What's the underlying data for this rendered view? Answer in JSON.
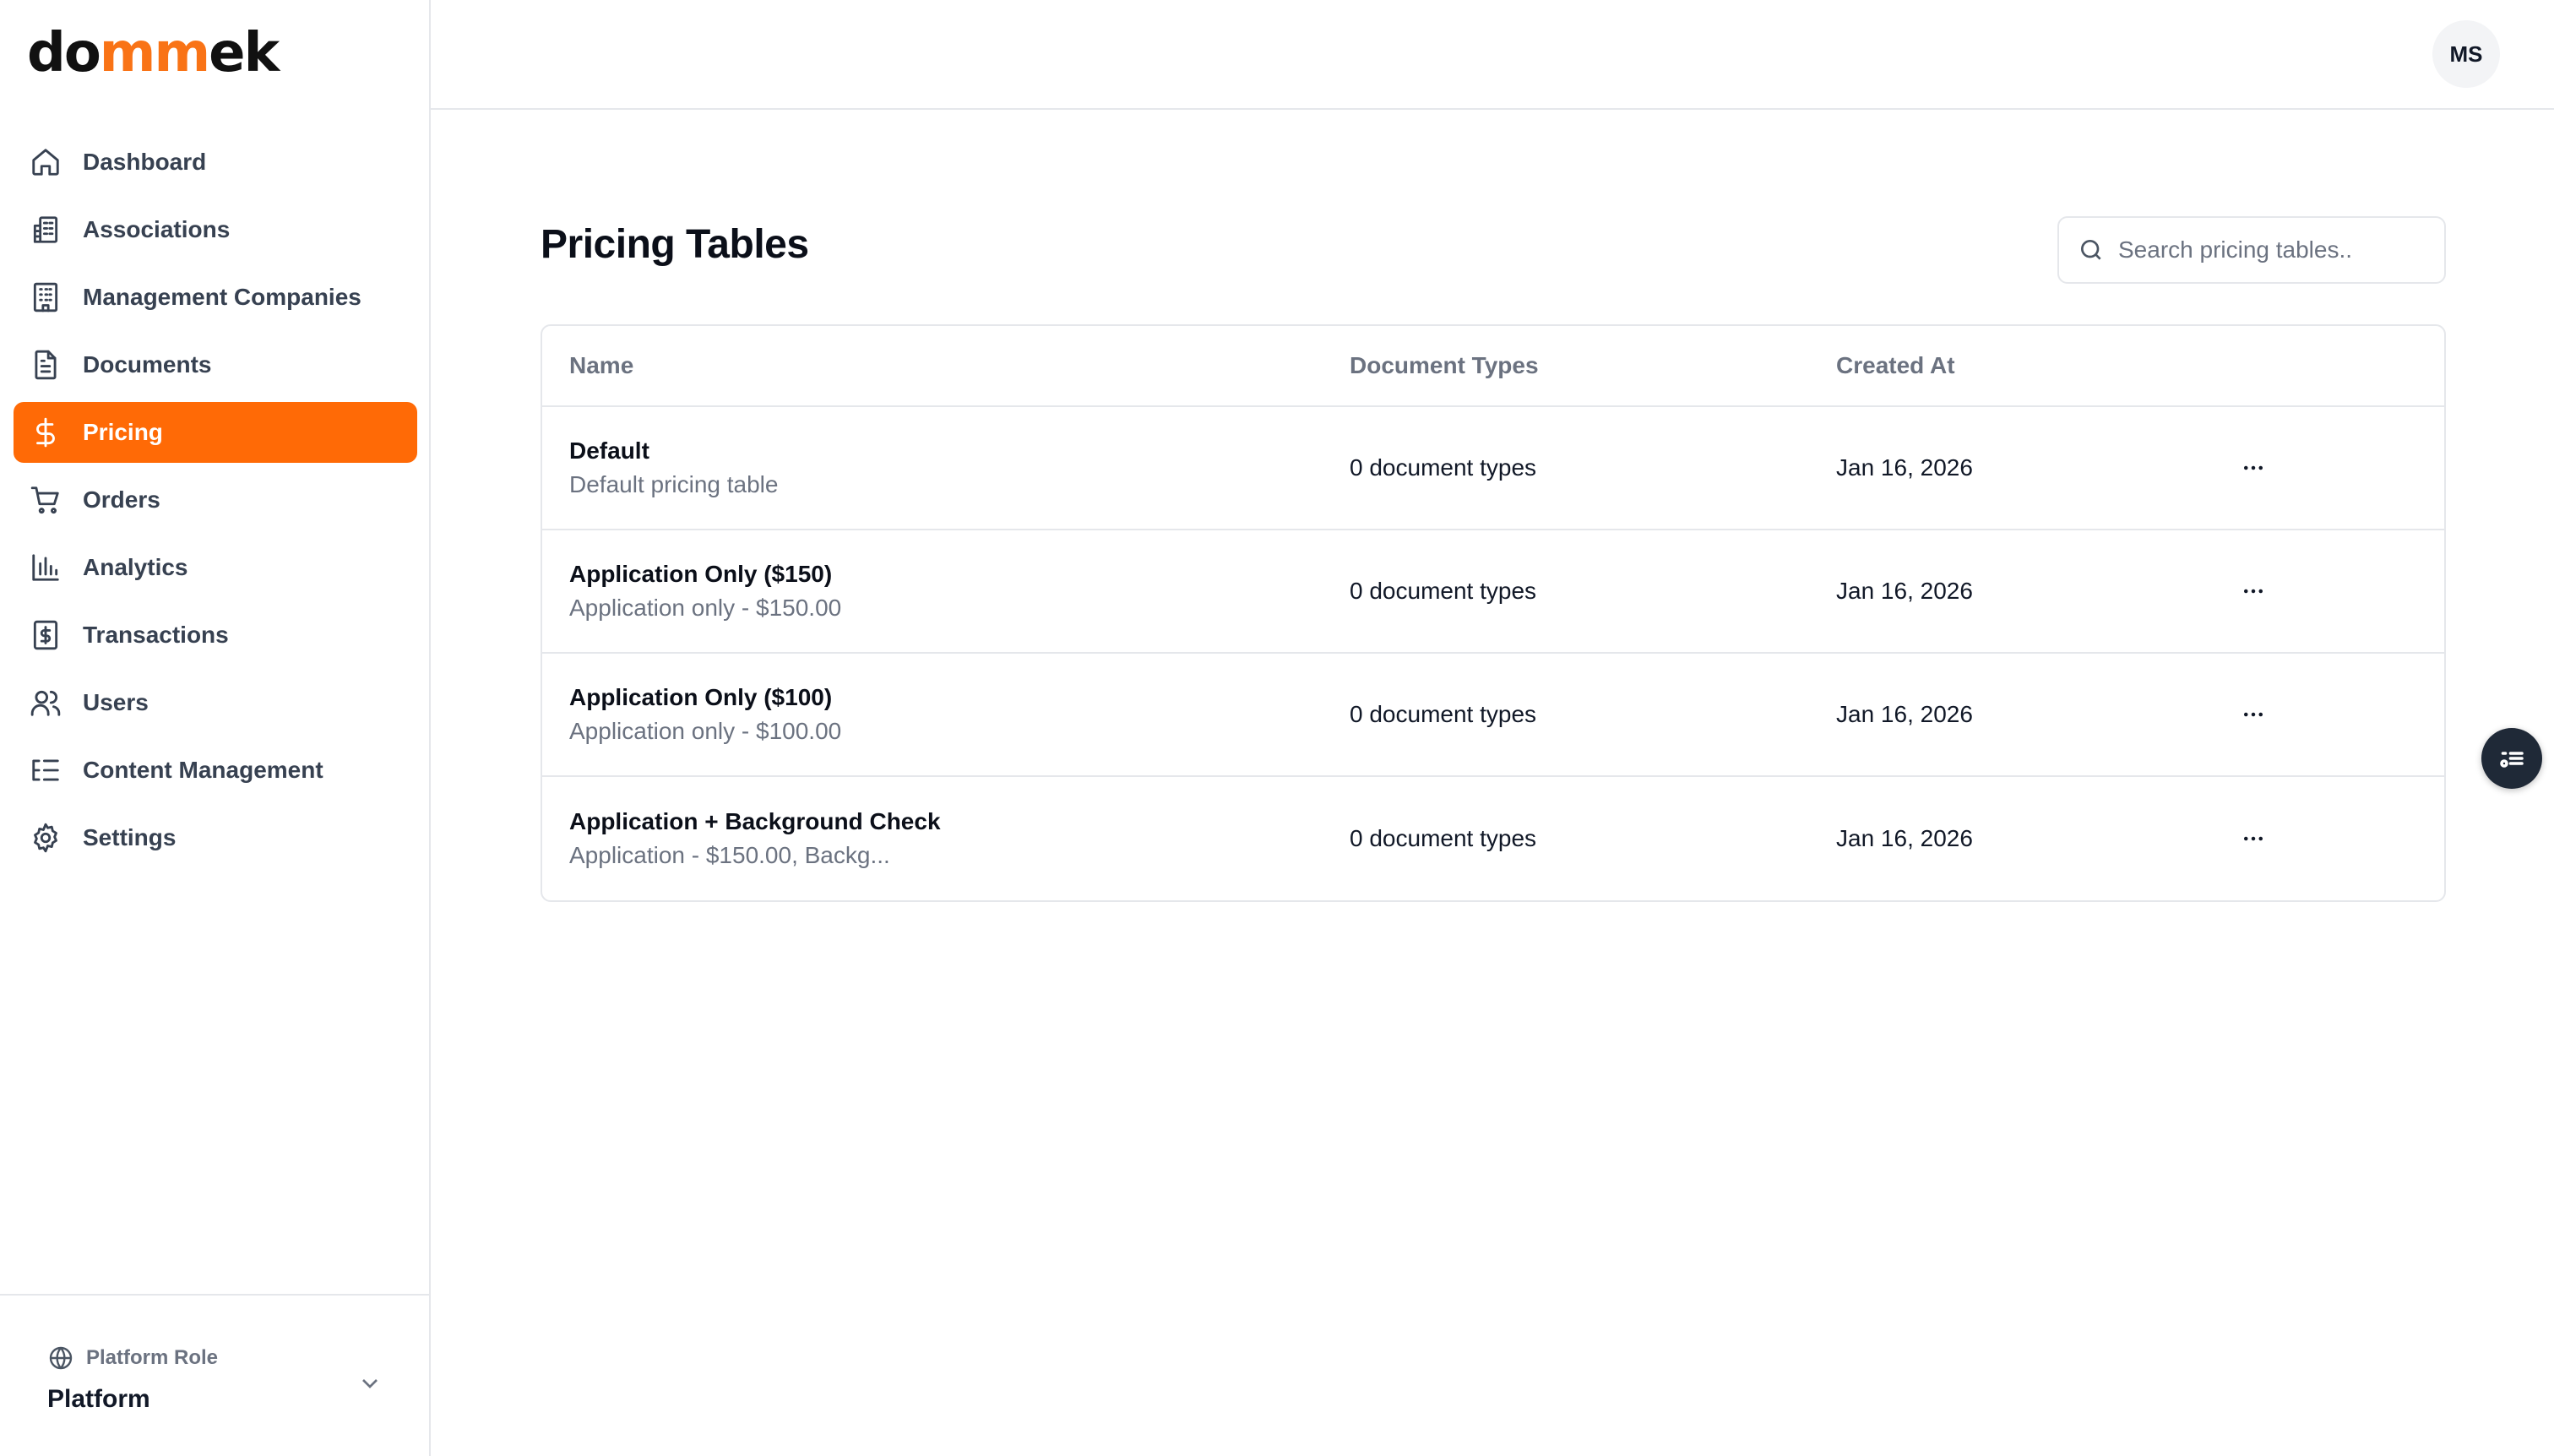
{
  "brand": {
    "logo_pre": "do",
    "logo_accent": "mm",
    "logo_post": "ek",
    "accent_color": "#ff6a06"
  },
  "sidebar": {
    "items": [
      {
        "label": "Dashboard",
        "icon": "home-icon",
        "active": false
      },
      {
        "label": "Associations",
        "icon": "buildings-icon",
        "active": false
      },
      {
        "label": "Management Companies",
        "icon": "office-building-icon",
        "active": false
      },
      {
        "label": "Documents",
        "icon": "document-icon",
        "active": false
      },
      {
        "label": "Pricing",
        "icon": "dollar-icon",
        "active": true
      },
      {
        "label": "Orders",
        "icon": "cart-icon",
        "active": false
      },
      {
        "label": "Analytics",
        "icon": "bar-chart-icon",
        "active": false
      },
      {
        "label": "Transactions",
        "icon": "receipt-dollar-icon",
        "active": false
      },
      {
        "label": "Users",
        "icon": "users-icon",
        "active": false
      },
      {
        "label": "Content Management",
        "icon": "list-tree-icon",
        "active": false
      },
      {
        "label": "Settings",
        "icon": "gear-icon",
        "active": false
      }
    ],
    "footer": {
      "role_label": "Platform Role",
      "role_value": "Platform"
    }
  },
  "header": {
    "avatar_initials": "MS"
  },
  "main": {
    "title": "Pricing Tables",
    "search": {
      "placeholder": "Search pricing tables..",
      "value": ""
    },
    "table": {
      "columns": [
        "Name",
        "Document Types",
        "Created At",
        ""
      ],
      "rows": [
        {
          "name": "Default",
          "description": "Default pricing table",
          "document_types": "0 document types",
          "created_at": "Jan 16, 2026"
        },
        {
          "name": "Application Only ($150)",
          "description": "Application only - $150.00",
          "document_types": "0 document types",
          "created_at": "Jan 16, 2026"
        },
        {
          "name": "Application Only ($100)",
          "description": "Application only - $100.00",
          "document_types": "0 document types",
          "created_at": "Jan 16, 2026"
        },
        {
          "name": "Application + Background Check",
          "description": "Application - $150.00, Backg...",
          "document_types": "0 document types",
          "created_at": "Jan 16, 2026"
        }
      ]
    }
  }
}
